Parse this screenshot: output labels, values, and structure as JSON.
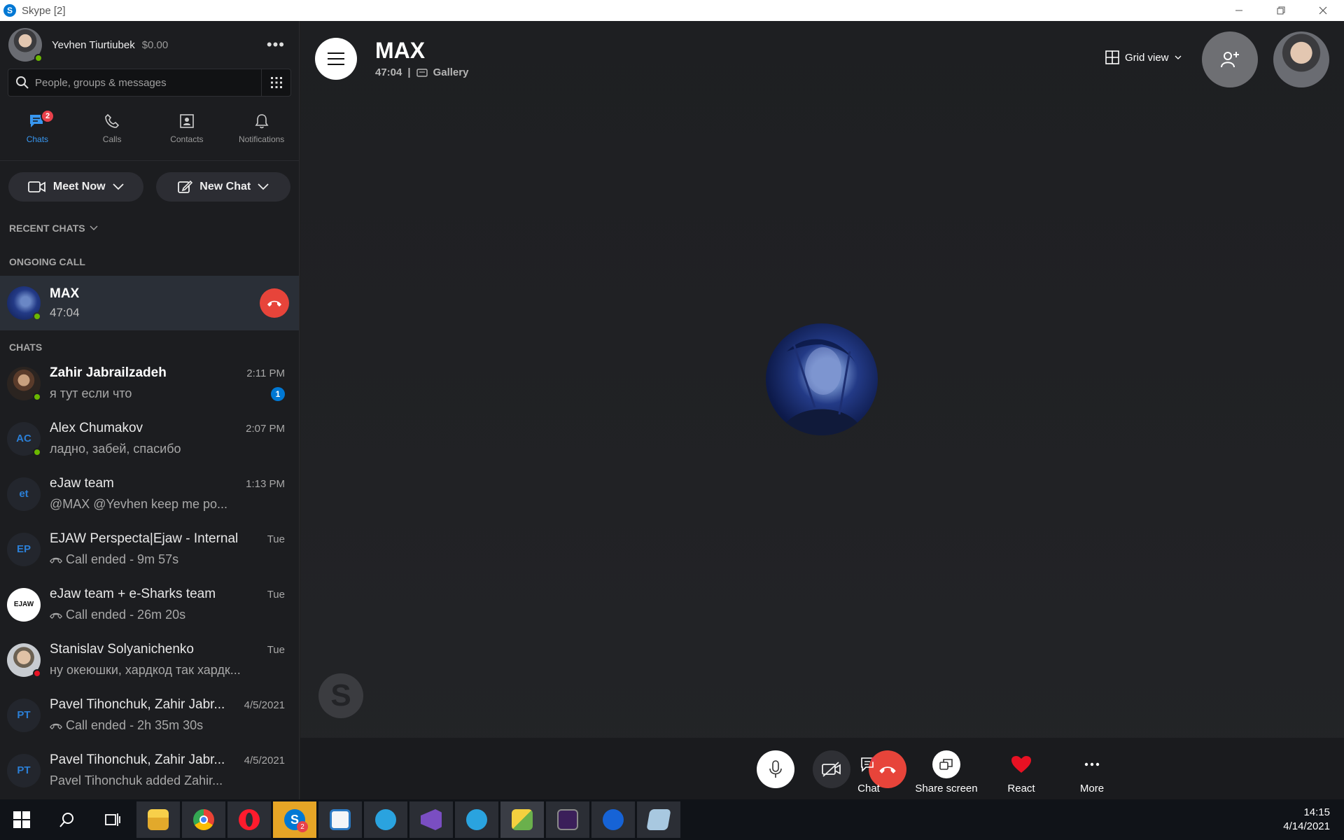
{
  "window": {
    "title": "Skype [2]",
    "icon_letter": "S"
  },
  "profile": {
    "name": "Yevhen Tiurtiubek",
    "credit": "$0.00",
    "more": "•••"
  },
  "search": {
    "placeholder": "People, groups & messages"
  },
  "nav": [
    {
      "label": "Chats",
      "badge": "2",
      "icon": "chat-icon",
      "active": true
    },
    {
      "label": "Calls",
      "icon": "phone-icon"
    },
    {
      "label": "Contacts",
      "icon": "contacts-icon"
    },
    {
      "label": "Notifications",
      "icon": "bell-icon"
    }
  ],
  "actions": {
    "meet_now": "Meet Now",
    "new_chat": "New Chat"
  },
  "sections": {
    "recent": "RECENT CHATS",
    "ongoing": "ONGOING CALL",
    "chats": "CHATS"
  },
  "ongoing_call": {
    "name": "MAX",
    "time": "47:04"
  },
  "chats": [
    {
      "name": "Zahir Jabrailzadeh",
      "time": "2:11 PM",
      "preview": "я тут если что",
      "unread": "1",
      "bold": true,
      "avatar": "photo",
      "status": "online"
    },
    {
      "name": "Alex Chumakov",
      "time": "2:07 PM",
      "preview": "ладно, забей, спасибо",
      "initials": "AC",
      "status": "online"
    },
    {
      "name": "eJaw team",
      "time": "1:13 PM",
      "preview": "@MAX @Yevhen keep me po...",
      "initials": "et"
    },
    {
      "name": "EJAW Perspecta|Ejaw - Internal",
      "time": "Tue",
      "preview": "Call ended - 9m 57s",
      "initials": "EP",
      "call_icon": true
    },
    {
      "name": "eJaw team + e-Sharks team",
      "time": "Tue",
      "preview": "Call ended - 26m 20s",
      "avatar": "logo",
      "logo_text": "EJAW",
      "call_icon": true
    },
    {
      "name": "Stanislav Solyanichenko",
      "time": "Tue",
      "preview": "ну океюшки, хардкод так хардк...",
      "avatar": "photo",
      "status": "busy"
    },
    {
      "name": "Pavel Tihonchuk, Zahir Jabr...",
      "time": "4/5/2021",
      "preview": "Call ended - 2h 35m 30s",
      "initials": "PT",
      "call_icon": true
    },
    {
      "name": "Pavel Tihonchuk, Zahir Jabr...",
      "time": "4/5/2021",
      "preview": "Pavel Tihonchuk added Zahir...",
      "initials": "PT"
    }
  ],
  "call": {
    "name": "MAX",
    "elapsed": "47:04",
    "separator": "|",
    "mode": "Gallery",
    "view": "Grid view",
    "watermark": "S"
  },
  "controls": {
    "chat": "Chat",
    "share": "Share screen",
    "react": "React",
    "more": "More"
  },
  "taskbar": {
    "apps": [
      "start-icon",
      "search-icon",
      "task-view-icon",
      "file-explorer-icon",
      "chrome-icon",
      "opera-icon",
      "skype-icon",
      "snipping-icon",
      "telegram-icon",
      "visual-studio-icon",
      "telegram-icon",
      "paint-icon",
      "terminal-icon",
      "maps-icon",
      "notes-icon"
    ],
    "skype_badge": "2",
    "time": "14:15",
    "date": "4/14/2021"
  },
  "colors": {
    "accent": "#0078d4",
    "hangup": "#e7443a",
    "online": "#6bb700",
    "busy": "#e81123"
  }
}
